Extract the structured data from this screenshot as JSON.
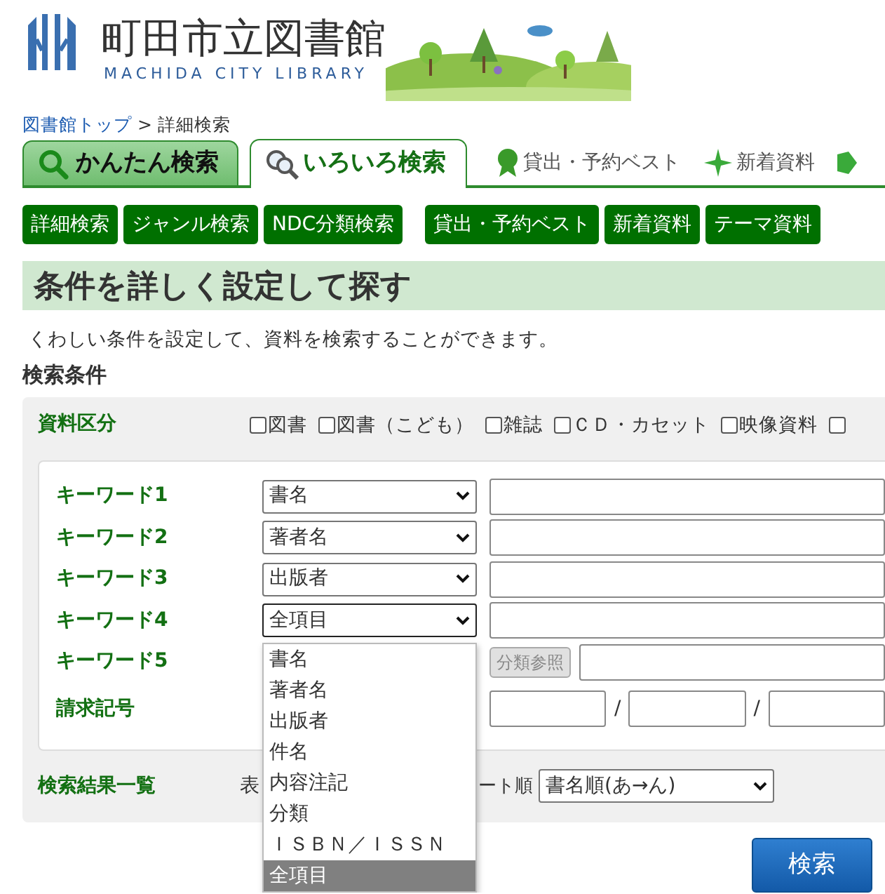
{
  "header": {
    "title": "町田市立図書館",
    "subtitle": "MACHIDA CITY LIBRARY"
  },
  "breadcrumb": {
    "items": [
      {
        "label": "図書館トップ",
        "link": true
      },
      {
        "label": "詳細検索",
        "link": false
      }
    ],
    "separator": ">"
  },
  "tabs": [
    {
      "label": "かんたん検索",
      "selected": false
    },
    {
      "label": "いろいろ検索",
      "selected": true
    }
  ],
  "nav_links": [
    {
      "kind": "rosette",
      "label": "貸出・予約ベスト"
    },
    {
      "kind": "sparkle",
      "label": "新着資料"
    },
    {
      "kind": "tag"
    }
  ],
  "menu_groups": [
    [
      "詳細検索",
      "ジャンル検索",
      "NDC分類検索"
    ],
    [
      "貸出・予約ベスト",
      "新着資料",
      "テーマ資料"
    ]
  ],
  "heading": "条件を詳しく設定して探す",
  "description": "くわしい条件を設定して、資料を検索することができます。",
  "section_title": "検索条件",
  "material_type": {
    "label": "資料区分",
    "options": [
      {
        "label": "図書",
        "checked": false
      },
      {
        "label": "図書（こども）",
        "checked": false
      },
      {
        "label": "雑誌",
        "checked": false
      },
      {
        "label": "ＣＤ・カセット",
        "checked": false
      },
      {
        "label": "映像資料",
        "checked": false
      },
      {
        "checked": false
      }
    ]
  },
  "keywords": [
    {
      "label": "キーワード1",
      "kind": "field",
      "field": "書名",
      "focused": false
    },
    {
      "label": "キーワード2",
      "kind": "field",
      "field": "著者名",
      "focused": false
    },
    {
      "label": "キーワード3",
      "kind": "field",
      "field": "出版者",
      "focused": false
    },
    {
      "label": "キーワード4",
      "kind": "field",
      "field": "全項目",
      "focused": true
    },
    {
      "label": "キーワード5",
      "kind": "classification",
      "button": "分類参照",
      "disabled": true
    }
  ],
  "call_number": {
    "label": "請求記号",
    "separators": [
      "/",
      "/"
    ]
  },
  "dropdown": {
    "options": [
      {
        "label": "書名",
        "selected": false
      },
      {
        "label": "著者名",
        "selected": false
      },
      {
        "label": "出版者",
        "selected": false
      },
      {
        "label": "件名",
        "selected": false
      },
      {
        "label": "内容注記",
        "selected": false
      },
      {
        "label": "分類",
        "selected": false
      },
      {
        "label": "ＩＳＢＮ／ＩＳＳＮ",
        "selected": false
      },
      {
        "label": "全項目",
        "selected": true
      }
    ]
  },
  "results": {
    "label": "検索結果一覧",
    "text_before": "表",
    "text_after": "ート順",
    "sort": "書名順(あ→ん)"
  },
  "search_button": "検索"
}
